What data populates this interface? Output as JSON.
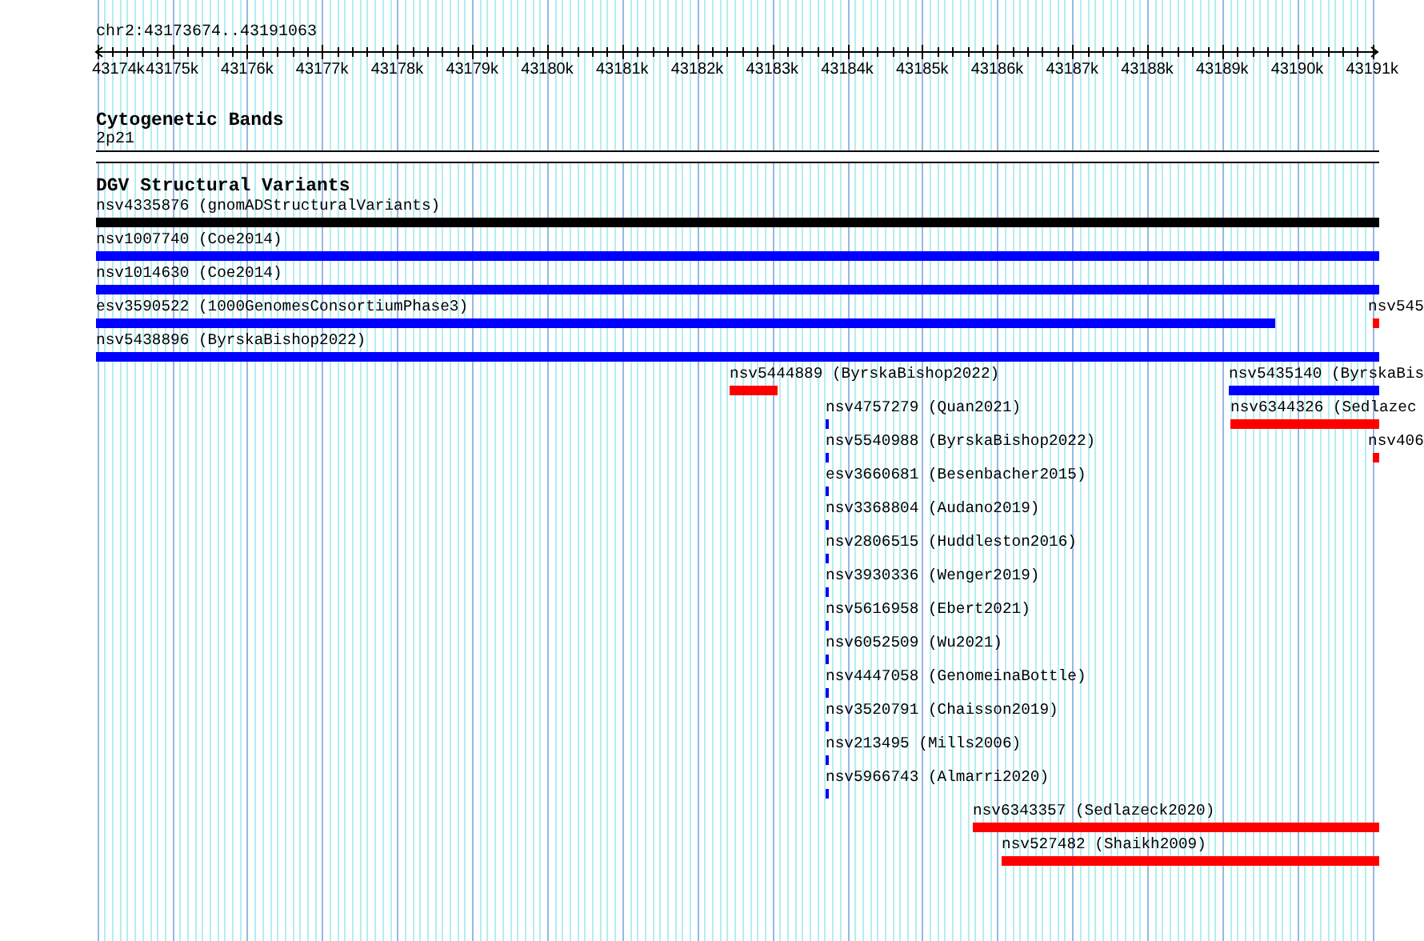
{
  "ruler": {
    "location": "chr2:43173674..43191063",
    "ticks": [
      "43174k",
      "43175k",
      "43176k",
      "43177k",
      "43178k",
      "43179k",
      "43180k",
      "43181k",
      "43182k",
      "43183k",
      "43184k",
      "43185k",
      "43186k",
      "43187k",
      "43188k",
      "43189k",
      "43190k",
      "43191k"
    ]
  },
  "cytogenetic_bands": {
    "title": "Cytogenetic Bands",
    "bands": [
      {
        "name": "2p21"
      }
    ]
  },
  "dgv_structural_variants": {
    "title": "DGV Structural Variants",
    "rows": [
      [
        {
          "label": "nsv4335876 (gnomADStructuralVariants)",
          "color": "#000000"
        }
      ],
      [
        {
          "label": "nsv1007740 (Coe2014)",
          "color": "#0000ff"
        }
      ],
      [
        {
          "label": "nsv1014630 (Coe2014)",
          "color": "#0000ff"
        }
      ],
      [
        {
          "label": "esv3590522 (1000GenomesConsortiumPhase3)",
          "color": "#0000ff"
        },
        {
          "label": "nsv545",
          "color": "#ff0000"
        }
      ],
      [
        {
          "label": "nsv5438896 (ByrskaBishop2022)",
          "color": "#0000ff"
        }
      ],
      [
        {
          "label": "nsv5444889 (ByrskaBishop2022)",
          "color": "#ff0000"
        },
        {
          "label": "nsv5435140 (ByrskaBis",
          "color": "#0000ff"
        }
      ],
      [
        {
          "label": "nsv4757279 (Quan2021)",
          "color": "#0000ff"
        },
        {
          "label": "nsv6344326 (Sedlazec",
          "color": "#ff0000"
        }
      ],
      [
        {
          "label": "nsv5540988 (ByrskaBishop2022)",
          "color": "#0000ff"
        },
        {
          "label": "nsv406",
          "color": "#ff0000"
        }
      ],
      [
        {
          "label": "esv3660681 (Besenbacher2015)",
          "color": "#0000ff"
        }
      ],
      [
        {
          "label": "nsv3368804 (Audano2019)",
          "color": "#0000ff"
        }
      ],
      [
        {
          "label": "nsv2806515 (Huddleston2016)",
          "color": "#0000ff"
        }
      ],
      [
        {
          "label": "nsv3930336 (Wenger2019)",
          "color": "#0000ff"
        }
      ],
      [
        {
          "label": "nsv5616958 (Ebert2021)",
          "color": "#0000ff"
        }
      ],
      [
        {
          "label": "nsv6052509 (Wu2021)",
          "color": "#0000ff"
        }
      ],
      [
        {
          "label": "nsv4447058 (GenomeinaBottle)",
          "color": "#0000ff"
        }
      ],
      [
        {
          "label": "nsv3520791 (Chaisson2019)",
          "color": "#0000ff"
        }
      ],
      [
        {
          "label": "nsv213495 (Mills2006)",
          "color": "#0000ff"
        }
      ],
      [
        {
          "label": "nsv5966743 (Almarri2020)",
          "color": "#0000ff"
        }
      ],
      [
        {
          "label": "nsv6343357 (Sedlazeck2020)",
          "color": "#ff0000"
        }
      ],
      [
        {
          "label": "nsv527482 (Shaikh2009)",
          "color": "#ff0000"
        }
      ]
    ]
  }
}
